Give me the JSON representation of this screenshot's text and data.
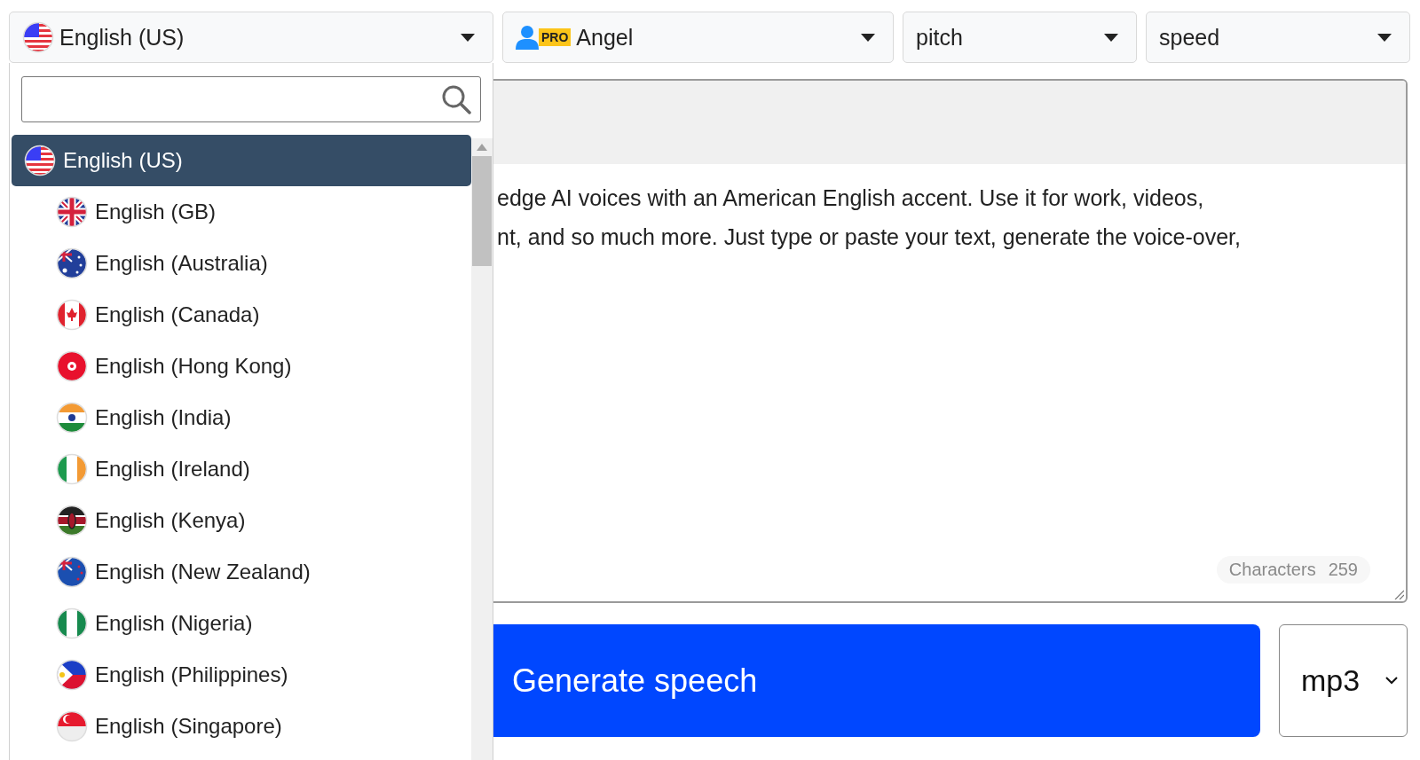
{
  "language_select": {
    "value": "English (US)"
  },
  "voice_select": {
    "badge": "PRO",
    "value": "Angel"
  },
  "pitch_select": {
    "value": "pitch"
  },
  "speed_select": {
    "value": "speed"
  },
  "language_dropdown": {
    "items": [
      {
        "label": "English (US)",
        "selected": true
      },
      {
        "label": "English (GB)",
        "selected": false
      },
      {
        "label": "English (Australia)",
        "selected": false
      },
      {
        "label": "English (Canada)",
        "selected": false
      },
      {
        "label": "English (Hong Kong)",
        "selected": false
      },
      {
        "label": "English (India)",
        "selected": false
      },
      {
        "label": "English (Ireland)",
        "selected": false
      },
      {
        "label": "English (Kenya)",
        "selected": false
      },
      {
        "label": "English (New Zealand)",
        "selected": false
      },
      {
        "label": "English (Nigeria)",
        "selected": false
      },
      {
        "label": "English (Philippines)",
        "selected": false
      },
      {
        "label": "English (Singapore)",
        "selected": false
      }
    ]
  },
  "editor": {
    "lines": [
      "edge AI voices with an American English accent. Use it for work, videos,",
      "nt, and so much more. Just type or paste your text, generate the voice-over,"
    ],
    "counter": {
      "label": "Characters",
      "value": "259"
    }
  },
  "generate_button": {
    "label": "Generate speech"
  },
  "format_select": {
    "value": "mp3"
  }
}
